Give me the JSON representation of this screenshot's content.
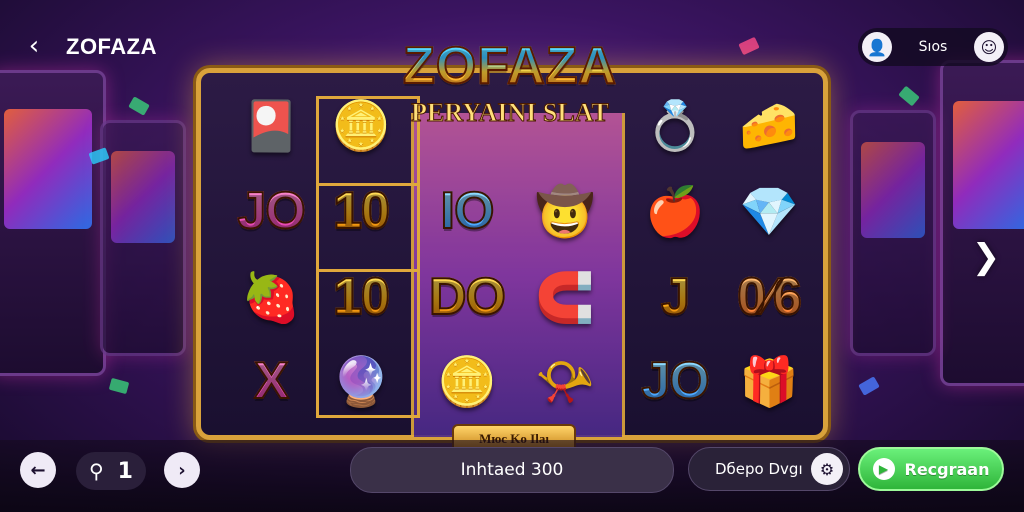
{
  "header": {
    "back_icon": "chevron-left-icon",
    "title": "ZOFAZA",
    "right_value": "Sıos",
    "avatar_icon": "user-icon",
    "menu_icon": "smiley-icon"
  },
  "logo": {
    "title": "ZOFAZA",
    "subtitle": "PERYAINI SLAT"
  },
  "reels": [
    [
      {
        "type": "icon",
        "name": "ticket-card-icon",
        "glyph": "🎴"
      },
      {
        "type": "text",
        "text": "JO",
        "style": "pink"
      },
      {
        "type": "icon",
        "name": "strawberry-icon",
        "glyph": "🍓"
      },
      {
        "type": "text",
        "text": "X",
        "style": "pink"
      }
    ],
    [
      {
        "type": "icon",
        "name": "treasure-chest-icon",
        "glyph": "🪙"
      },
      {
        "type": "text",
        "text": "10",
        "style": "gold"
      },
      {
        "type": "text",
        "text": "10",
        "style": "gold"
      },
      {
        "type": "icon",
        "name": "gem-rose-icon",
        "glyph": "🔮"
      }
    ],
    [
      {
        "type": "text",
        "text": "IO",
        "style": "blue"
      },
      {
        "type": "text",
        "text": "DO",
        "style": "gold"
      },
      {
        "type": "icon",
        "name": "gold-bar-icon",
        "glyph": "🪙"
      }
    ],
    [
      {
        "type": "icon",
        "name": "cowboy-character-icon",
        "glyph": "🤠"
      },
      {
        "type": "icon",
        "name": "golden-horseshoe-icon",
        "glyph": "🧲"
      },
      {
        "type": "icon",
        "name": "golden-horn-icon",
        "glyph": "📯"
      }
    ],
    [
      {
        "type": "icon",
        "name": "ring-icon",
        "glyph": "💍"
      },
      {
        "type": "icon",
        "name": "apple-icon",
        "glyph": "🍎"
      },
      {
        "type": "text",
        "text": "J",
        "style": "gold"
      },
      {
        "type": "text",
        "text": "JO",
        "style": "blue"
      }
    ],
    [
      {
        "type": "icon",
        "name": "cheese-wedge-icon",
        "glyph": "🧀"
      },
      {
        "type": "icon",
        "name": "blue-gem-icon",
        "glyph": "💎"
      },
      {
        "type": "text",
        "text": "0⁄6",
        "style": "orange"
      },
      {
        "type": "icon",
        "name": "gift-box-icon",
        "glyph": "🎁"
      }
    ]
  ],
  "machine": {
    "plaque": "Mюс Ko Ilaı"
  },
  "side_arrow_icon": "chevron-right-icon",
  "footer": {
    "prev_icon": "arrow-left-icon",
    "lines_icon": "key-icon",
    "lines_value": "1",
    "next_icon": "chevron-right-icon",
    "balance_text": "Inhtaed 300",
    "bet_label": "Dберо Dvgı",
    "bet_icon": "settings-icon",
    "spin_label": "Recgraan",
    "spin_icon": "play-icon"
  },
  "colors": {
    "frame_gold": "#d9a23b",
    "spin_green": "#2fb53a",
    "bg_purple": "#3a1460"
  }
}
